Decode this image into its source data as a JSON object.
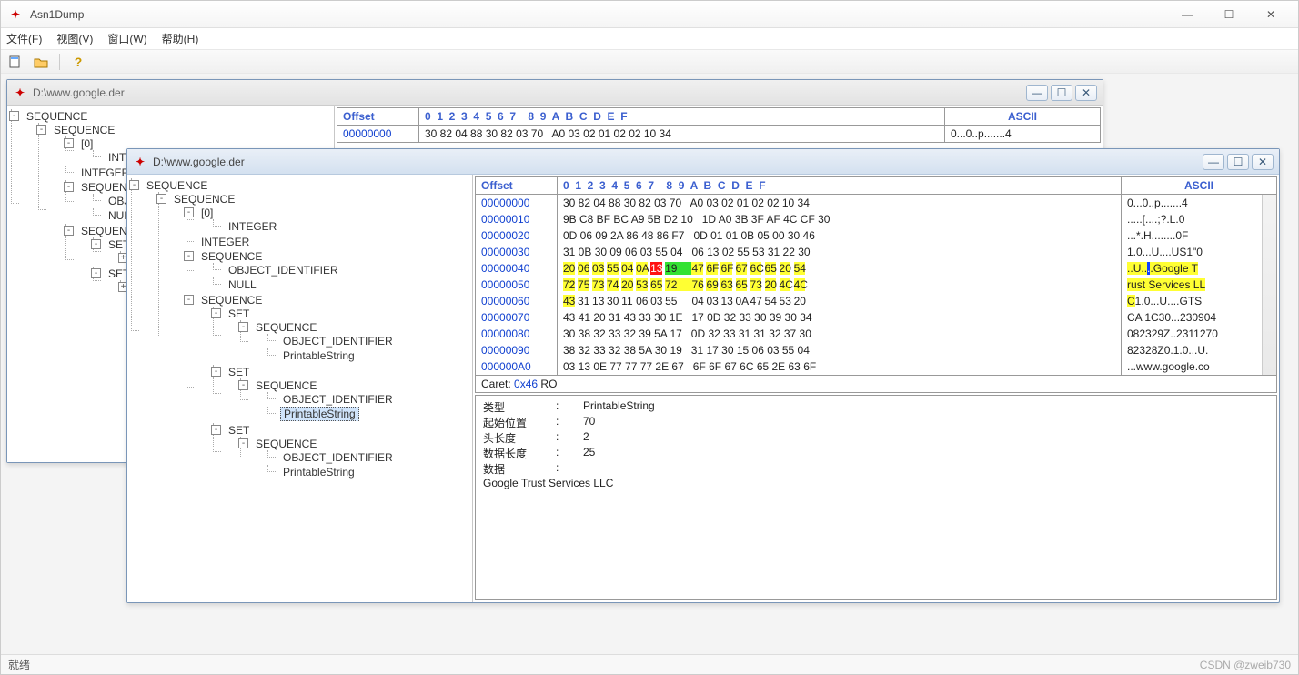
{
  "app": {
    "title": "Asn1Dump"
  },
  "menus": [
    "文件(F)",
    "视图(V)",
    "窗口(W)",
    "帮助(H)"
  ],
  "status": {
    "left": "就绪",
    "right": "CSDN @zweib730"
  },
  "child1": {
    "title": "D:\\www.google.der",
    "tree": [
      "SEQUENCE",
      "SEQUENCE",
      "[0]",
      "INTEGER",
      "INTEGER",
      "SEQUENCE",
      "OBJECT_IDENTIFIER",
      "NULL",
      "SEQUENCE",
      "SET",
      "SEQUENCE",
      "SET",
      "SEQUENCE"
    ],
    "hex_header": {
      "offset": "Offset",
      "cols": "0  1  2  3  4  5  6  7    8  9  A  B  C  D  E  F",
      "ascii": "ASCII"
    },
    "hex_rows": [
      {
        "off": "00000000",
        "h": "30 82 04 88 30 82 03 70   A0 03 02 01 02 02 10 34",
        "a": "0...0..p.......4"
      }
    ]
  },
  "child2": {
    "title": "D:\\www.google.der",
    "tree_selected": "PrintableString",
    "tree": [
      {
        "t": "SEQUENCE",
        "d": 0,
        "e": "-"
      },
      {
        "t": "SEQUENCE",
        "d": 1,
        "e": "-"
      },
      {
        "t": "[0]",
        "d": 2,
        "e": "-"
      },
      {
        "t": "INTEGER",
        "d": 3
      },
      {
        "t": "INTEGER",
        "d": 2
      },
      {
        "t": "SEQUENCE",
        "d": 2,
        "e": "-"
      },
      {
        "t": "OBJECT_IDENTIFIER",
        "d": 3
      },
      {
        "t": "NULL",
        "d": 3
      },
      {
        "t": "SEQUENCE",
        "d": 2,
        "e": "-"
      },
      {
        "t": "SET",
        "d": 3,
        "e": "-"
      },
      {
        "t": "SEQUENCE",
        "d": 4,
        "e": "-"
      },
      {
        "t": "OBJECT_IDENTIFIER",
        "d": 5
      },
      {
        "t": "PrintableString",
        "d": 5
      },
      {
        "t": "SET",
        "d": 3,
        "e": "-"
      },
      {
        "t": "SEQUENCE",
        "d": 4,
        "e": "-"
      },
      {
        "t": "OBJECT_IDENTIFIER",
        "d": 5
      },
      {
        "t": "PrintableString",
        "d": 5,
        "sel": true
      },
      {
        "t": "SET",
        "d": 3,
        "e": "-"
      },
      {
        "t": "SEQUENCE",
        "d": 4,
        "e": "-"
      },
      {
        "t": "OBJECT_IDENTIFIER",
        "d": 5
      },
      {
        "t": "PrintableString",
        "d": 5
      }
    ],
    "hex_header": {
      "offset": "Offset",
      "cols": "0  1  2  3  4  5  6  7    8  9  A  B  C  D  E  F",
      "ascii": "ASCII"
    },
    "hex_rows": [
      {
        "off": "00000000",
        "l": "30 82 04 88 30 82 03 70",
        "r": "A0 03 02 01 02 02 10 34",
        "a": "0...0..p.......4"
      },
      {
        "off": "00000010",
        "l": "9B C8 BF BC A9 5B D2 10",
        "r": "1D A0 3B 3F AF 4C CF 30",
        "a": ".....[....;?.L.0"
      },
      {
        "off": "00000020",
        "l": "0D 06 09 2A 86 48 86 F7",
        "r": "0D 01 01 0B 05 00 30 46",
        "a": "...*.H........0F"
      },
      {
        "off": "00000030",
        "l": "31 0B 30 09 06 03 55 04",
        "r": "06 13 02 55 53 31 22 30",
        "a": "1.0...U....US1\"0"
      },
      {
        "off": "00000040",
        "hl": true,
        "cells_l": [
          {
            "t": "20",
            "c": "y"
          },
          {
            "t": "06",
            "c": "y"
          },
          {
            "t": "03",
            "c": "y"
          },
          {
            "t": "55",
            "c": "y"
          },
          {
            "t": "04",
            "c": "y"
          },
          {
            "t": "0A",
            "c": "y"
          },
          {
            "t": "13",
            "c": "r"
          },
          {
            "t": "19",
            "c": "g"
          }
        ],
        "cells_r": [
          {
            "t": "47",
            "c": "y"
          },
          {
            "t": "6F",
            "c": "y"
          },
          {
            "t": "6F",
            "c": "y"
          },
          {
            "t": "67",
            "c": "y"
          },
          {
            "t": "6C",
            "c": "y"
          },
          {
            "t": "65",
            "c": "y"
          },
          {
            "t": "20",
            "c": "y"
          },
          {
            "t": "54",
            "c": "y"
          }
        ],
        "a_cells": [
          {
            "t": " ",
            "c": "y"
          },
          {
            "t": ".",
            "c": "y"
          },
          {
            "t": ".",
            "c": "y"
          },
          {
            "t": "U",
            "c": "y"
          },
          {
            "t": ".",
            "c": "y"
          },
          {
            "t": ".",
            "c": "y"
          },
          {
            "t": ".",
            "c": "b"
          },
          {
            "t": ".",
            "c": "y"
          },
          {
            "t": "G",
            "c": "y"
          },
          {
            "t": "o",
            "c": "y"
          },
          {
            "t": "o",
            "c": "y"
          },
          {
            "t": "g",
            "c": "y"
          },
          {
            "t": "l",
            "c": "y"
          },
          {
            "t": "e",
            "c": "y"
          },
          {
            "t": " ",
            "c": "y"
          },
          {
            "t": "T",
            "c": "y"
          }
        ]
      },
      {
        "off": "00000050",
        "hl": true,
        "cells_l": [
          {
            "t": "72",
            "c": "y"
          },
          {
            "t": "75",
            "c": "y"
          },
          {
            "t": "73",
            "c": "y"
          },
          {
            "t": "74",
            "c": "y"
          },
          {
            "t": "20",
            "c": "y"
          },
          {
            "t": "53",
            "c": "y"
          },
          {
            "t": "65",
            "c": "y"
          },
          {
            "t": "72",
            "c": "y"
          }
        ],
        "cells_r": [
          {
            "t": "76",
            "c": "y"
          },
          {
            "t": "69",
            "c": "y"
          },
          {
            "t": "63",
            "c": "y"
          },
          {
            "t": "65",
            "c": "y"
          },
          {
            "t": "73",
            "c": "y"
          },
          {
            "t": "20",
            "c": "y"
          },
          {
            "t": "4C",
            "c": "y"
          },
          {
            "t": "4C",
            "c": "y"
          }
        ],
        "a_cells": [
          {
            "t": "r",
            "c": "y"
          },
          {
            "t": "u",
            "c": "y"
          },
          {
            "t": "s",
            "c": "y"
          },
          {
            "t": "t",
            "c": "y"
          },
          {
            "t": " ",
            "c": "y"
          },
          {
            "t": "S",
            "c": "y"
          },
          {
            "t": "e",
            "c": "y"
          },
          {
            "t": "r",
            "c": "y"
          },
          {
            "t": "v",
            "c": "y"
          },
          {
            "t": "i",
            "c": "y"
          },
          {
            "t": "c",
            "c": "y"
          },
          {
            "t": "e",
            "c": "y"
          },
          {
            "t": "s",
            "c": "y"
          },
          {
            "t": " ",
            "c": "y"
          },
          {
            "t": "L",
            "c": "y"
          },
          {
            "t": "L",
            "c": "y"
          }
        ]
      },
      {
        "off": "00000060",
        "hl": true,
        "cells_l": [
          {
            "t": "43",
            "c": "y"
          },
          {
            "t": "31"
          },
          {
            "t": "13"
          },
          {
            "t": "30"
          },
          {
            "t": "11"
          },
          {
            "t": "06"
          },
          {
            "t": "03"
          },
          {
            "t": "55"
          }
        ],
        "cells_r": [
          {
            "t": "04"
          },
          {
            "t": "03"
          },
          {
            "t": "13"
          },
          {
            "t": "0A"
          },
          {
            "t": "47"
          },
          {
            "t": "54"
          },
          {
            "t": "53"
          },
          {
            "t": "20"
          }
        ],
        "a_cells": [
          {
            "t": "C",
            "c": "y"
          },
          {
            "t": "1"
          },
          {
            "t": "."
          },
          {
            "t": "0"
          },
          {
            "t": "."
          },
          {
            "t": "."
          },
          {
            "t": "."
          },
          {
            "t": "U"
          },
          {
            "t": "."
          },
          {
            "t": "."
          },
          {
            "t": "."
          },
          {
            "t": "."
          },
          {
            "t": "G"
          },
          {
            "t": "T"
          },
          {
            "t": "S"
          },
          {
            "t": " "
          }
        ]
      },
      {
        "off": "00000070",
        "l": "43 41 20 31 43 33 30 1E",
        "r": "17 0D 32 33 30 39 30 34",
        "a": "CA 1C30...230904"
      },
      {
        "off": "00000080",
        "l": "30 38 32 33 32 39 5A 17",
        "r": "0D 32 33 31 31 32 37 30",
        "a": "082329Z..2311270"
      },
      {
        "off": "00000090",
        "l": "38 32 33 32 38 5A 30 19",
        "r": "31 17 30 15 06 03 55 04",
        "a": "82328Z0.1.0...U."
      },
      {
        "off": "000000A0",
        "l": "03 13 0E 77 77 77 2E 67",
        "r": "6F 6F 67 6C 65 2E 63 6F",
        "a": "...www.google.co"
      }
    ],
    "caret": {
      "label": "Caret:",
      "value": "0x46",
      "suffix": "RO"
    },
    "detail": {
      "k1": "类型",
      "v1": "PrintableString",
      "k2": "起始位置",
      "v2": "70",
      "k3": "头长度",
      "v3": "2",
      "k4": "数据长度",
      "v4": "25",
      "k5": "数据",
      "v5": "",
      "data": "Google Trust Services LLC"
    }
  }
}
